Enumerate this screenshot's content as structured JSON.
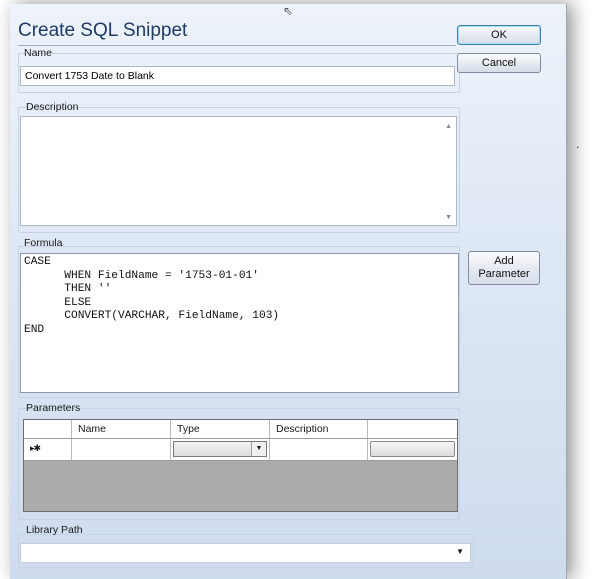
{
  "dialog": {
    "title": "Create SQL Snippet"
  },
  "name": {
    "label": "Name",
    "value": "Convert 1753 Date to Blank"
  },
  "description": {
    "label": "Description",
    "value": ""
  },
  "formula": {
    "label": "Formula",
    "code": "CASE\n      WHEN FieldName = '1753-01-01'\n      THEN ''\n      ELSE\n      CONVERT(VARCHAR, FieldName, 103)\nEND"
  },
  "buttons": {
    "ok": "OK",
    "cancel": "Cancel",
    "add_parameter": "Add\nParameter"
  },
  "parameters": {
    "label": "Parameters",
    "columns": [
      "",
      "Name",
      "Type",
      "Description",
      ""
    ],
    "new_row_marker": "▸✱",
    "rows": []
  },
  "library_path": {
    "label": "Library Path",
    "value": ""
  },
  "icons": {
    "cursor": "mouse-cursor-icon",
    "scroll_up": "scroll-up-arrow-icon",
    "scroll_down": "scroll-down-arrow-icon",
    "dropdown": "dropdown-arrow-icon"
  },
  "background_mark": "."
}
